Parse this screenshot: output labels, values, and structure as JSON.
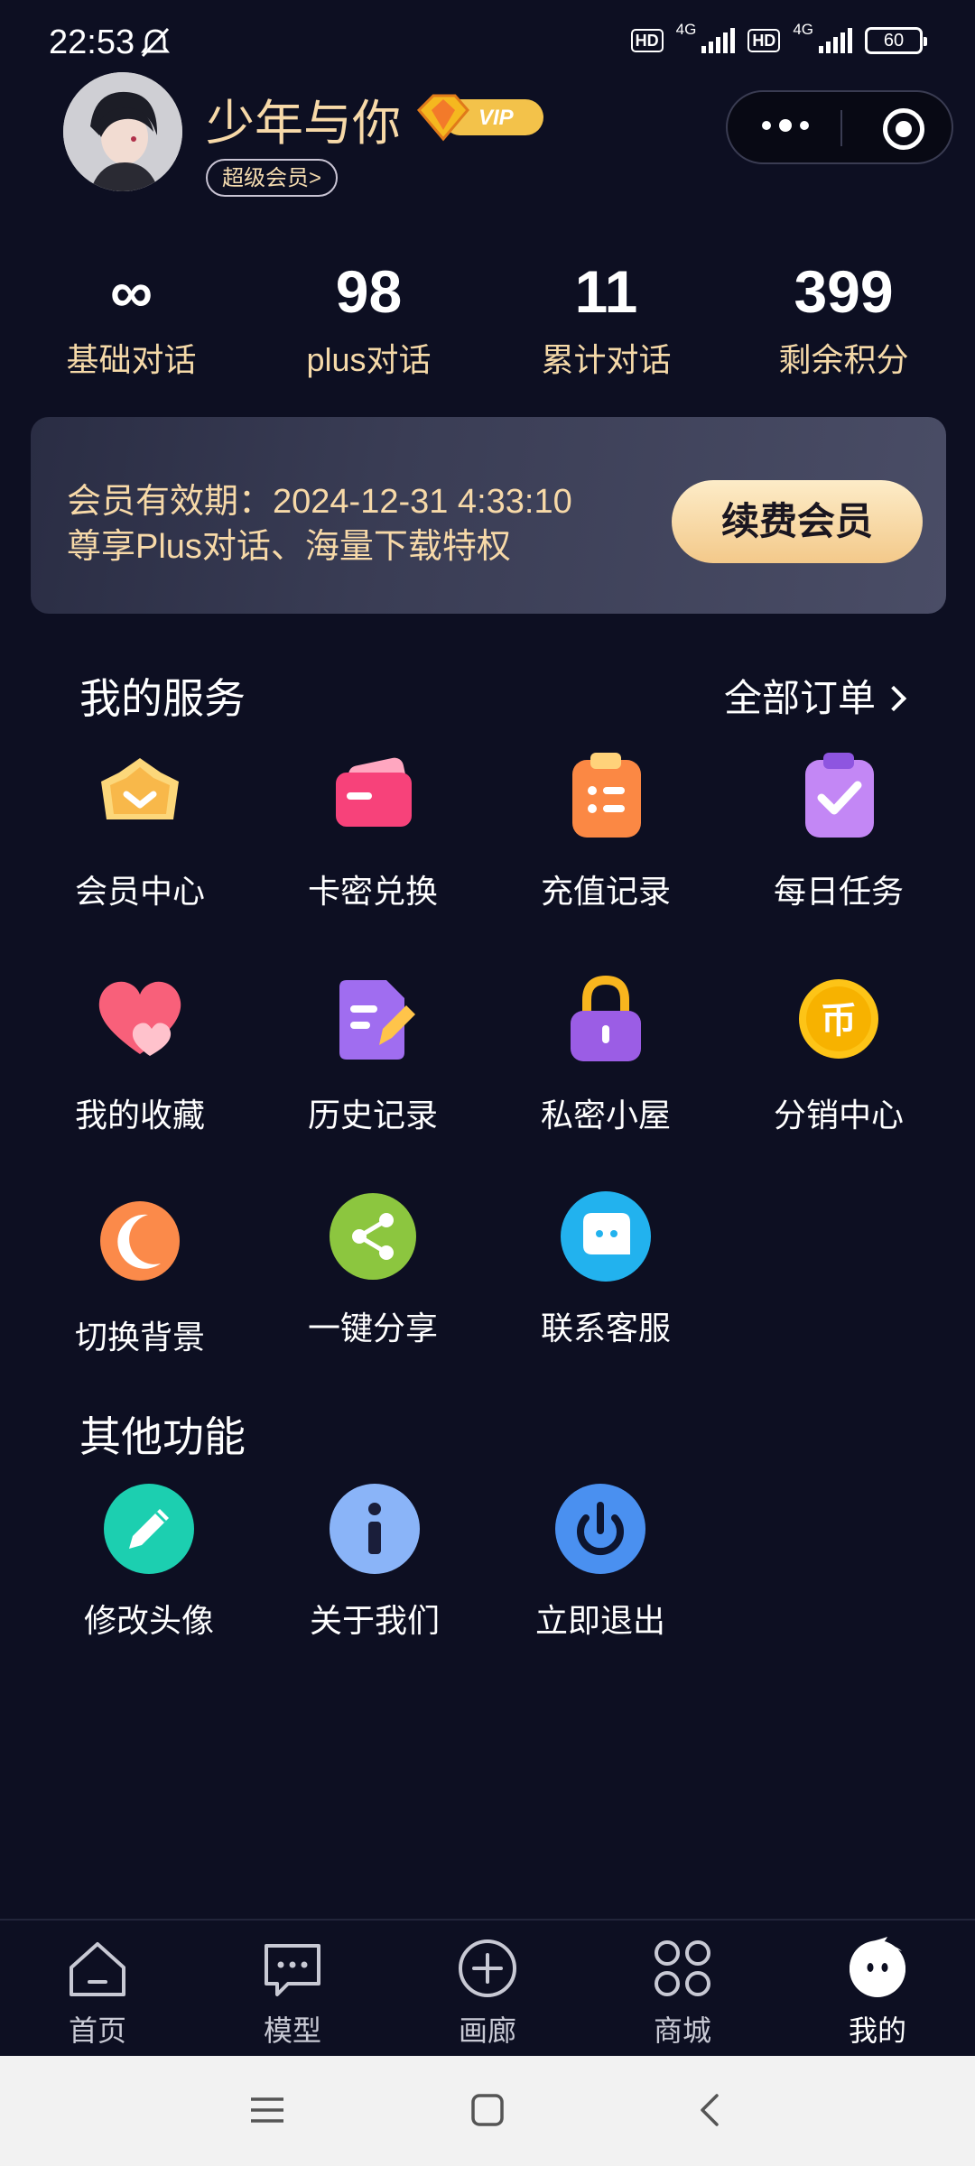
{
  "status_bar": {
    "time": "22:53",
    "network1": "4G",
    "network2": "4G",
    "battery": "60",
    "hd": "HD"
  },
  "profile": {
    "name": "少年与你",
    "vip_label": "VIP",
    "member_tag": "超级会员>"
  },
  "stats": [
    {
      "value": "∞",
      "label": "基础对话"
    },
    {
      "value": "98",
      "label": "plus对话"
    },
    {
      "value": "11",
      "label": "累计对话"
    },
    {
      "value": "399",
      "label": "剩余积分"
    }
  ],
  "membership": {
    "validity": "会员有效期：2024-12-31 4:33:10",
    "benefit": "尊享Plus对话、海量下载特权",
    "renew_label": "续费会员"
  },
  "services": {
    "title": "我的服务",
    "all_orders": "全部订单",
    "items": [
      {
        "label": "会员中心",
        "icon": "crown-icon"
      },
      {
        "label": "卡密兑换",
        "icon": "card-icon"
      },
      {
        "label": "充值记录",
        "icon": "clipboard-list-icon"
      },
      {
        "label": "每日任务",
        "icon": "task-check-icon"
      },
      {
        "label": "我的收藏",
        "icon": "heart-icon"
      },
      {
        "label": "历史记录",
        "icon": "history-doc-icon"
      },
      {
        "label": "私密小屋",
        "icon": "lock-icon"
      },
      {
        "label": "分销中心",
        "icon": "coin-icon"
      },
      {
        "label": "切换背景",
        "icon": "moon-icon"
      },
      {
        "label": "一键分享",
        "icon": "share-icon"
      },
      {
        "label": "联系客服",
        "icon": "chat-bubble-icon"
      }
    ]
  },
  "other": {
    "title": "其他功能",
    "items": [
      {
        "label": "修改头像",
        "icon": "pencil-icon"
      },
      {
        "label": "关于我们",
        "icon": "info-icon"
      },
      {
        "label": "立即退出",
        "icon": "power-icon"
      }
    ]
  },
  "tabbar": [
    {
      "label": "首页",
      "icon": "home-icon"
    },
    {
      "label": "模型",
      "icon": "message-icon"
    },
    {
      "label": "画廊",
      "icon": "plus-circle-icon"
    },
    {
      "label": "商城",
      "icon": "grid-icon"
    },
    {
      "label": "我的",
      "icon": "profile-face-icon",
      "active": true
    }
  ],
  "colors": {
    "background": "#0d0f22",
    "gold_text": "#f7d9a8",
    "renew_button": "#f3c98a"
  }
}
